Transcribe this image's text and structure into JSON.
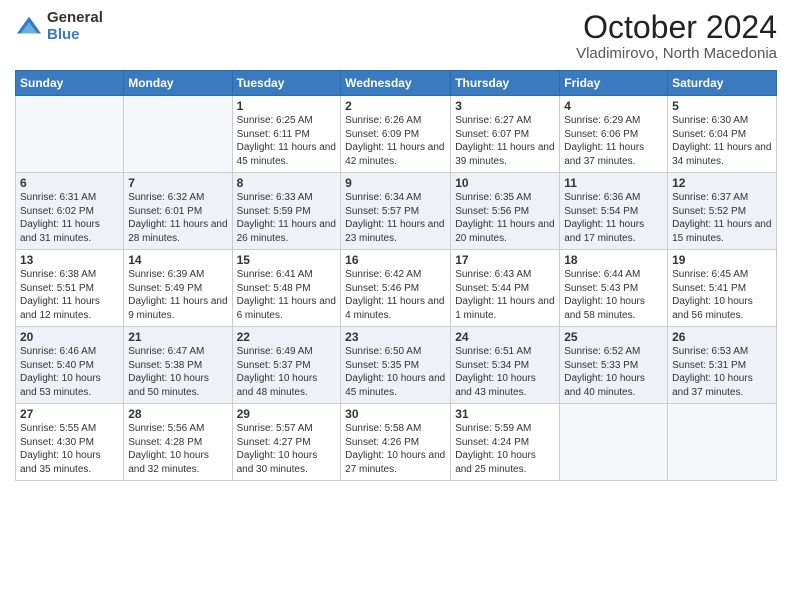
{
  "logo": {
    "general": "General",
    "blue": "Blue"
  },
  "title": "October 2024",
  "subtitle": "Vladimirovo, North Macedonia",
  "days_of_week": [
    "Sunday",
    "Monday",
    "Tuesday",
    "Wednesday",
    "Thursday",
    "Friday",
    "Saturday"
  ],
  "weeks": [
    [
      {
        "day": "",
        "sunrise": "",
        "sunset": "",
        "daylight": ""
      },
      {
        "day": "",
        "sunrise": "",
        "sunset": "",
        "daylight": ""
      },
      {
        "day": "1",
        "sunrise": "Sunrise: 6:25 AM",
        "sunset": "Sunset: 6:11 PM",
        "daylight": "Daylight: 11 hours and 45 minutes."
      },
      {
        "day": "2",
        "sunrise": "Sunrise: 6:26 AM",
        "sunset": "Sunset: 6:09 PM",
        "daylight": "Daylight: 11 hours and 42 minutes."
      },
      {
        "day": "3",
        "sunrise": "Sunrise: 6:27 AM",
        "sunset": "Sunset: 6:07 PM",
        "daylight": "Daylight: 11 hours and 39 minutes."
      },
      {
        "day": "4",
        "sunrise": "Sunrise: 6:29 AM",
        "sunset": "Sunset: 6:06 PM",
        "daylight": "Daylight: 11 hours and 37 minutes."
      },
      {
        "day": "5",
        "sunrise": "Sunrise: 6:30 AM",
        "sunset": "Sunset: 6:04 PM",
        "daylight": "Daylight: 11 hours and 34 minutes."
      }
    ],
    [
      {
        "day": "6",
        "sunrise": "Sunrise: 6:31 AM",
        "sunset": "Sunset: 6:02 PM",
        "daylight": "Daylight: 11 hours and 31 minutes."
      },
      {
        "day": "7",
        "sunrise": "Sunrise: 6:32 AM",
        "sunset": "Sunset: 6:01 PM",
        "daylight": "Daylight: 11 hours and 28 minutes."
      },
      {
        "day": "8",
        "sunrise": "Sunrise: 6:33 AM",
        "sunset": "Sunset: 5:59 PM",
        "daylight": "Daylight: 11 hours and 26 minutes."
      },
      {
        "day": "9",
        "sunrise": "Sunrise: 6:34 AM",
        "sunset": "Sunset: 5:57 PM",
        "daylight": "Daylight: 11 hours and 23 minutes."
      },
      {
        "day": "10",
        "sunrise": "Sunrise: 6:35 AM",
        "sunset": "Sunset: 5:56 PM",
        "daylight": "Daylight: 11 hours and 20 minutes."
      },
      {
        "day": "11",
        "sunrise": "Sunrise: 6:36 AM",
        "sunset": "Sunset: 5:54 PM",
        "daylight": "Daylight: 11 hours and 17 minutes."
      },
      {
        "day": "12",
        "sunrise": "Sunrise: 6:37 AM",
        "sunset": "Sunset: 5:52 PM",
        "daylight": "Daylight: 11 hours and 15 minutes."
      }
    ],
    [
      {
        "day": "13",
        "sunrise": "Sunrise: 6:38 AM",
        "sunset": "Sunset: 5:51 PM",
        "daylight": "Daylight: 11 hours and 12 minutes."
      },
      {
        "day": "14",
        "sunrise": "Sunrise: 6:39 AM",
        "sunset": "Sunset: 5:49 PM",
        "daylight": "Daylight: 11 hours and 9 minutes."
      },
      {
        "day": "15",
        "sunrise": "Sunrise: 6:41 AM",
        "sunset": "Sunset: 5:48 PM",
        "daylight": "Daylight: 11 hours and 6 minutes."
      },
      {
        "day": "16",
        "sunrise": "Sunrise: 6:42 AM",
        "sunset": "Sunset: 5:46 PM",
        "daylight": "Daylight: 11 hours and 4 minutes."
      },
      {
        "day": "17",
        "sunrise": "Sunrise: 6:43 AM",
        "sunset": "Sunset: 5:44 PM",
        "daylight": "Daylight: 11 hours and 1 minute."
      },
      {
        "day": "18",
        "sunrise": "Sunrise: 6:44 AM",
        "sunset": "Sunset: 5:43 PM",
        "daylight": "Daylight: 10 hours and 58 minutes."
      },
      {
        "day": "19",
        "sunrise": "Sunrise: 6:45 AM",
        "sunset": "Sunset: 5:41 PM",
        "daylight": "Daylight: 10 hours and 56 minutes."
      }
    ],
    [
      {
        "day": "20",
        "sunrise": "Sunrise: 6:46 AM",
        "sunset": "Sunset: 5:40 PM",
        "daylight": "Daylight: 10 hours and 53 minutes."
      },
      {
        "day": "21",
        "sunrise": "Sunrise: 6:47 AM",
        "sunset": "Sunset: 5:38 PM",
        "daylight": "Daylight: 10 hours and 50 minutes."
      },
      {
        "day": "22",
        "sunrise": "Sunrise: 6:49 AM",
        "sunset": "Sunset: 5:37 PM",
        "daylight": "Daylight: 10 hours and 48 minutes."
      },
      {
        "day": "23",
        "sunrise": "Sunrise: 6:50 AM",
        "sunset": "Sunset: 5:35 PM",
        "daylight": "Daylight: 10 hours and 45 minutes."
      },
      {
        "day": "24",
        "sunrise": "Sunrise: 6:51 AM",
        "sunset": "Sunset: 5:34 PM",
        "daylight": "Daylight: 10 hours and 43 minutes."
      },
      {
        "day": "25",
        "sunrise": "Sunrise: 6:52 AM",
        "sunset": "Sunset: 5:33 PM",
        "daylight": "Daylight: 10 hours and 40 minutes."
      },
      {
        "day": "26",
        "sunrise": "Sunrise: 6:53 AM",
        "sunset": "Sunset: 5:31 PM",
        "daylight": "Daylight: 10 hours and 37 minutes."
      }
    ],
    [
      {
        "day": "27",
        "sunrise": "Sunrise: 5:55 AM",
        "sunset": "Sunset: 4:30 PM",
        "daylight": "Daylight: 10 hours and 35 minutes."
      },
      {
        "day": "28",
        "sunrise": "Sunrise: 5:56 AM",
        "sunset": "Sunset: 4:28 PM",
        "daylight": "Daylight: 10 hours and 32 minutes."
      },
      {
        "day": "29",
        "sunrise": "Sunrise: 5:57 AM",
        "sunset": "Sunset: 4:27 PM",
        "daylight": "Daylight: 10 hours and 30 minutes."
      },
      {
        "day": "30",
        "sunrise": "Sunrise: 5:58 AM",
        "sunset": "Sunset: 4:26 PM",
        "daylight": "Daylight: 10 hours and 27 minutes."
      },
      {
        "day": "31",
        "sunrise": "Sunrise: 5:59 AM",
        "sunset": "Sunset: 4:24 PM",
        "daylight": "Daylight: 10 hours and 25 minutes."
      },
      {
        "day": "",
        "sunrise": "",
        "sunset": "",
        "daylight": ""
      },
      {
        "day": "",
        "sunrise": "",
        "sunset": "",
        "daylight": ""
      }
    ]
  ]
}
